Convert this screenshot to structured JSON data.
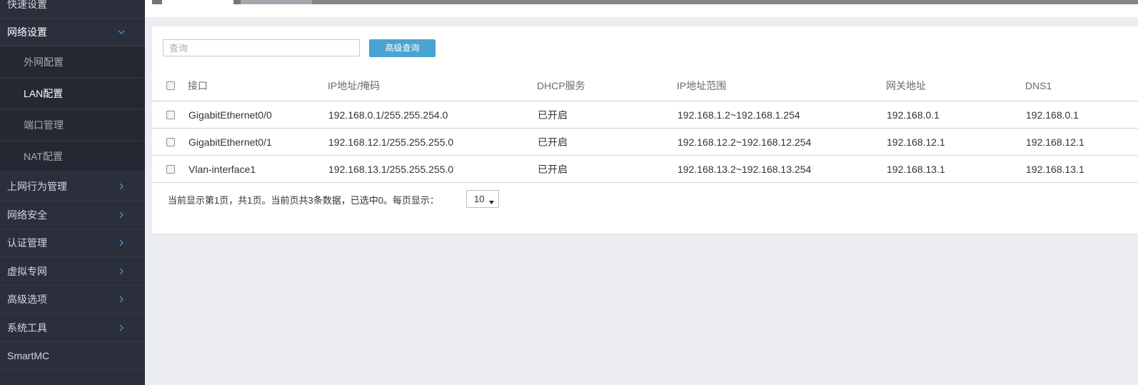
{
  "sidebar": {
    "items": [
      {
        "label": "快速设置"
      },
      {
        "label": "网络设置"
      },
      {
        "label": "上网行为管理"
      },
      {
        "label": "网络安全"
      },
      {
        "label": "认证管理"
      },
      {
        "label": "虚拟专网"
      },
      {
        "label": "高级选项"
      },
      {
        "label": "系统工具"
      },
      {
        "label": "SmartMC"
      }
    ],
    "sub_items": [
      {
        "label": "外网配置"
      },
      {
        "label": "LAN配置"
      },
      {
        "label": "端口管理"
      },
      {
        "label": "NAT配置"
      }
    ]
  },
  "toolbar": {
    "search_placeholder": "查询",
    "advanced_search_label": "高级查询"
  },
  "table": {
    "columns": [
      "接口",
      "IP地址/掩码",
      "DHCP服务",
      "IP地址范围",
      "网关地址",
      "DNS1"
    ],
    "rows": [
      [
        "GigabitEthernet0/0",
        "192.168.0.1/255.255.254.0",
        "已开启",
        "192.168.1.2~192.168.1.254",
        "192.168.0.1",
        "192.168.0.1"
      ],
      [
        "GigabitEthernet0/1",
        "192.168.12.1/255.255.255.0",
        "已开启",
        "192.168.12.2~192.168.12.254",
        "192.168.12.1",
        "192.168.12.1"
      ],
      [
        "Vlan-interface1",
        "192.168.13.1/255.255.255.0",
        "已开启",
        "192.168.13.2~192.168.13.254",
        "192.168.13.1",
        "192.168.13.1"
      ]
    ]
  },
  "pager": {
    "status_text": "当前显示第1页，共1页。当前页共3条数据，已选中0。每页显示：",
    "page_size": "10"
  },
  "colors": {
    "sidebar_bg": "#2a2f3b",
    "accent_button": "#4aa3d2",
    "chevron": "#3d8fd8"
  }
}
